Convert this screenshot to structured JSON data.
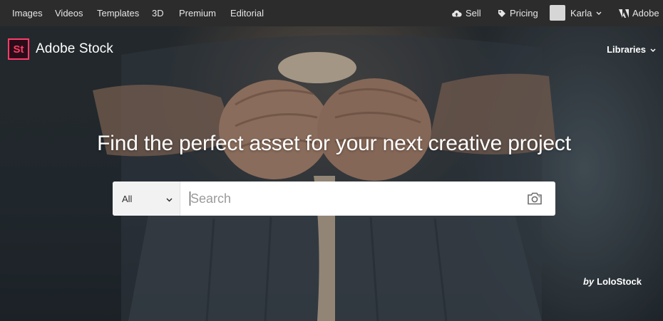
{
  "topnav": {
    "links": [
      "Images",
      "Videos",
      "Templates",
      "3D",
      "Premium",
      "Editorial"
    ],
    "sell": "Sell",
    "pricing": "Pricing",
    "user": "Karla",
    "adobe": "Adobe"
  },
  "brand": {
    "logo_mark": "St",
    "name": "Adobe Stock",
    "accent_color": "#ff3b6a"
  },
  "libraries": "Libraries",
  "hero": {
    "headline": "Find the perfect asset for your next creative project",
    "credit_by": "by",
    "credit_name": "LoloStock"
  },
  "search": {
    "scope": "All",
    "placeholder": "Search",
    "camera_icon": "camera-icon"
  }
}
